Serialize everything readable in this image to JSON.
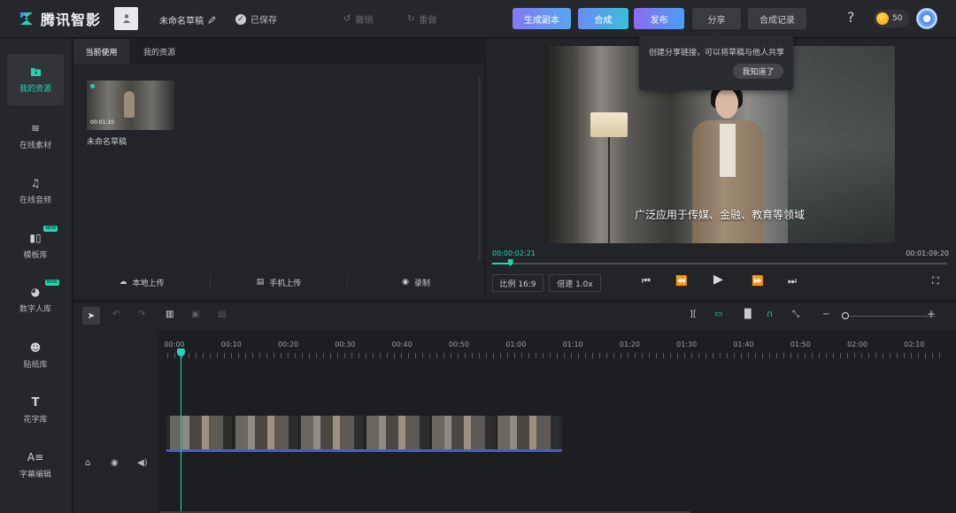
{
  "app": {
    "brand": "腾讯智影",
    "draft_name": "未命名草稿",
    "saved_status": "已保存",
    "undo": "撤销",
    "redo": "重做"
  },
  "topbar_buttons": {
    "generate_copy": "生成副本",
    "synthesize": "合成",
    "publish": "发布",
    "share": "分享",
    "synth_record": "合成记录"
  },
  "account": {
    "coins": "50"
  },
  "tooltip": {
    "text": "创建分享链接，可以将草稿与他人共享",
    "button": "我知道了"
  },
  "sidebar": {
    "items": [
      {
        "label": "我的资源",
        "icon": "folder-icon",
        "active": true,
        "new": false
      },
      {
        "label": "在线素材",
        "icon": "layers-icon",
        "active": false,
        "new": false
      },
      {
        "label": "在线音频",
        "icon": "music-note-icon",
        "active": false,
        "new": false
      },
      {
        "label": "模板库",
        "icon": "template-icon",
        "active": false,
        "new": true
      },
      {
        "label": "数字人库",
        "icon": "digital-human-icon",
        "active": false,
        "new": true
      },
      {
        "label": "贴纸库",
        "icon": "sticker-icon",
        "active": false,
        "new": false
      },
      {
        "label": "花字库",
        "icon": "text-icon",
        "active": false,
        "new": false
      },
      {
        "label": "字幕编辑",
        "icon": "subtitle-icon",
        "active": false,
        "new": false
      }
    ],
    "new_badge": "NEW"
  },
  "resources": {
    "tabs": [
      "当前使用",
      "我的资源"
    ],
    "active_tab": 0,
    "items": [
      {
        "name": "未命名草稿",
        "duration": "00:01:10"
      }
    ],
    "actions": [
      "本地上传",
      "手机上传",
      "录制"
    ]
  },
  "preview": {
    "subtitle": "广泛应用于传媒、金融、教育等领域",
    "current_time": "00:00:02:21",
    "total_time": "00:01:09:20",
    "progress": 0.04,
    "ratio": "比例 16:9",
    "speed": "倍速 1.0x"
  },
  "timeline": {
    "ruler": [
      "00:00",
      "00:10",
      "00:20",
      "00:30",
      "00:40",
      "00:50",
      "01:00",
      "01:10",
      "01:20",
      "01:30",
      "01:40",
      "01:50",
      "02:00",
      "02:10"
    ],
    "clip_frames": 6,
    "accent": "#1fd6b0",
    "clip_border": "#4a5ad0"
  },
  "colors": {
    "accent": "#1fd6b0",
    "background": "#1b1c1f",
    "panel": "#26272b"
  }
}
